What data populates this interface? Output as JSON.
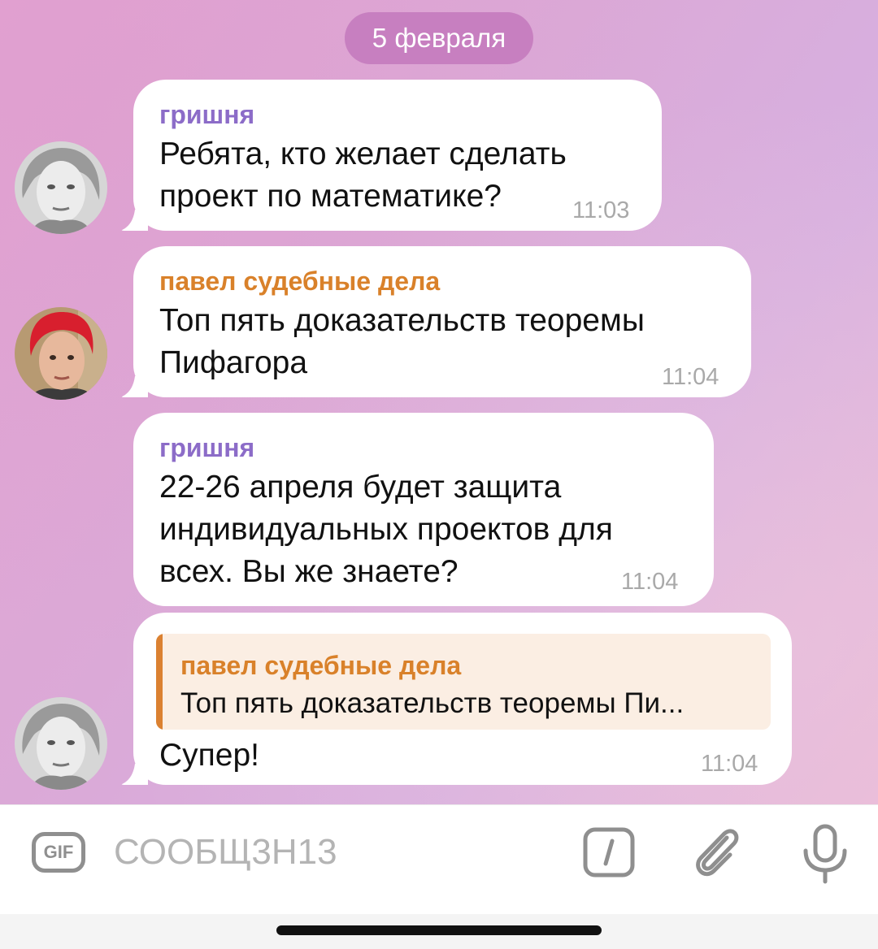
{
  "date_label": "5 февраля",
  "messages": [
    {
      "sender": "гришня",
      "text": "Ребята, кто желает сделать\nпроект по математике?",
      "time": "11:03"
    },
    {
      "sender": "павел судебные дела",
      "text": "Топ пять доказательств теоремы\nПифагора",
      "time": "11:04"
    },
    {
      "sender": "гришня",
      "text": "22-26 апреля будет защита\nиндивидуальных проектов для\nвсех. Вы же знаете?",
      "time": "11:04"
    },
    {
      "reply_to": {
        "sender": "павел судебные дела",
        "text": "Топ пять доказательств теоремы Пи..."
      },
      "text": "Супер!",
      "time": "11:04"
    }
  ],
  "composer": {
    "gif_label": "GIF",
    "placeholder": "СООБЩ3Н13"
  },
  "colors": {
    "name_purple": "#8c6cc8",
    "name_orange": "#d9812a",
    "quote_bar": "#db8131",
    "date_pill": "#c77fc0"
  }
}
